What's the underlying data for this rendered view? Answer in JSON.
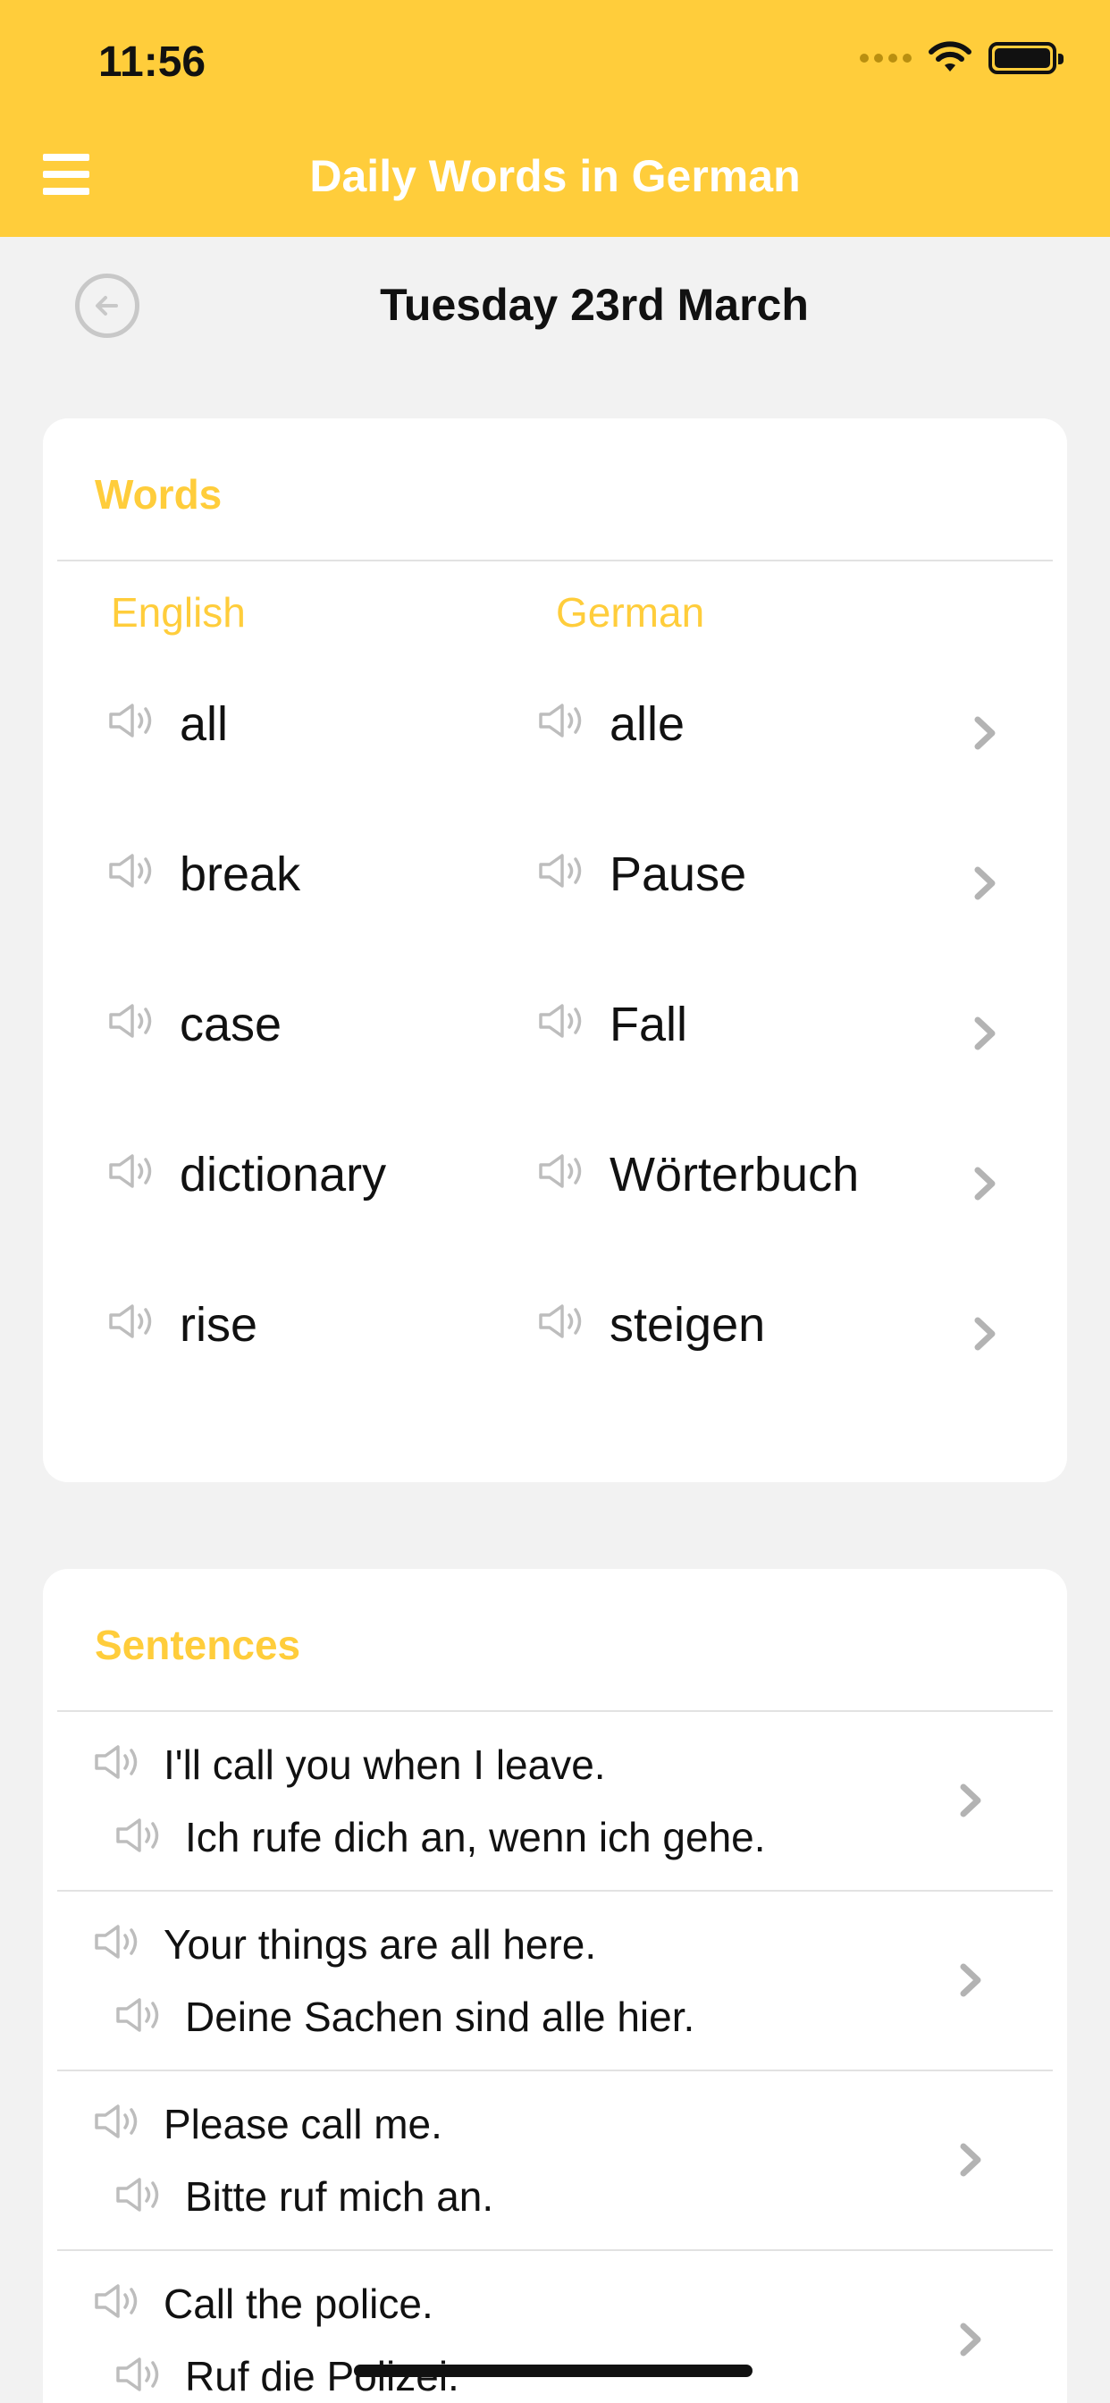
{
  "status_bar": {
    "time": "11:56"
  },
  "header": {
    "title": "Daily Words in German"
  },
  "date_nav": {
    "date": "Tuesday 23rd March"
  },
  "words": {
    "heading": "Words",
    "col_english": "English",
    "col_german": "German",
    "items": [
      {
        "en": "all",
        "de": "alle"
      },
      {
        "en": "break",
        "de": "Pause"
      },
      {
        "en": "case",
        "de": "Fall"
      },
      {
        "en": "dictionary",
        "de": "Wörterbuch"
      },
      {
        "en": "rise",
        "de": "steigen"
      }
    ]
  },
  "sentences": {
    "heading": "Sentences",
    "items": [
      {
        "en": "I'll call you when I leave.",
        "de": "Ich rufe dich an, wenn ich gehe."
      },
      {
        "en": "Your things are all here.",
        "de": "Deine Sachen sind alle hier."
      },
      {
        "en": "Please call me.",
        "de": "Bitte ruf mich an."
      },
      {
        "en": "Call the police.",
        "de": "Ruf die Polizei."
      }
    ]
  },
  "colors": {
    "accent": "#FFCD3B",
    "background": "#F2F2F2",
    "icon_gray": "#BDBDBD"
  },
  "icons": {
    "menu": "hamburger-icon",
    "back": "back-arrow-circle-icon",
    "speaker": "speaker-icon",
    "chevron": "chevron-right-icon",
    "wifi": "wifi-icon",
    "battery": "battery-icon"
  }
}
